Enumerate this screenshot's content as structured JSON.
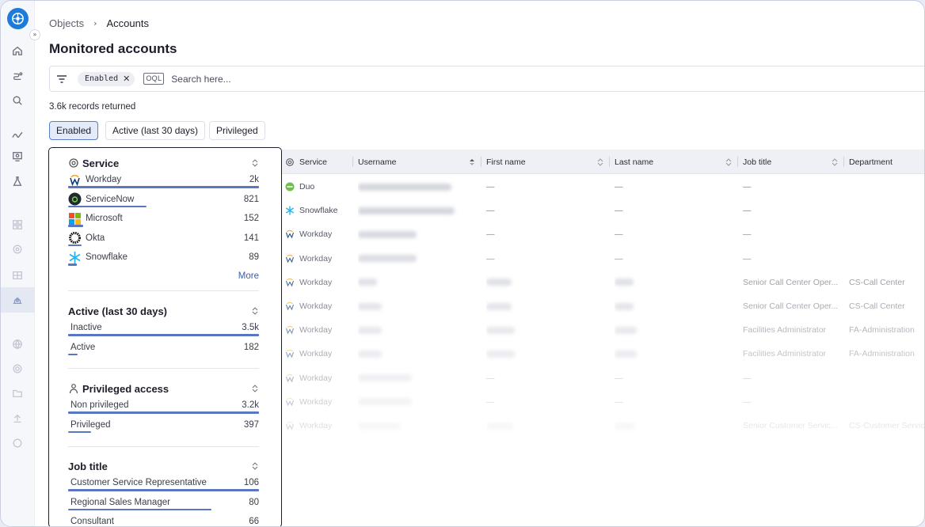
{
  "breadcrumb": {
    "root": "Objects",
    "current": "Accounts"
  },
  "page_title": "Monitored accounts",
  "search": {
    "chip_label": "Enabled",
    "oql_label": "OQL",
    "placeholder": "Search here..."
  },
  "records_returned": "3.6k records returned",
  "quick_filters": [
    "Enabled",
    "Active (last 30 days)",
    "Privileged"
  ],
  "facets": {
    "service": {
      "title": "Service",
      "items": [
        {
          "label": "Workday",
          "count": "2k",
          "fraction": 1.0
        },
        {
          "label": "ServiceNow",
          "count": "821",
          "fraction": 0.41
        },
        {
          "label": "Microsoft",
          "count": "152",
          "fraction": 0.08
        },
        {
          "label": "Okta",
          "count": "141",
          "fraction": 0.07
        },
        {
          "label": "Snowflake",
          "count": "89",
          "fraction": 0.045
        }
      ],
      "more_label": "More"
    },
    "active": {
      "title": "Active (last 30 days)",
      "items": [
        {
          "label": "Inactive",
          "count": "3.5k",
          "fraction": 1.0
        },
        {
          "label": "Active",
          "count": "182",
          "fraction": 0.05
        }
      ]
    },
    "privileged": {
      "title": "Privileged access",
      "items": [
        {
          "label": "Non privileged",
          "count": "3.2k",
          "fraction": 1.0
        },
        {
          "label": "Privileged",
          "count": "397",
          "fraction": 0.12
        }
      ]
    },
    "job_title": {
      "title": "Job title",
      "items": [
        {
          "label": "Customer Service Representative",
          "count": "106",
          "fraction": 1.0
        },
        {
          "label": "Regional Sales Manager",
          "count": "80",
          "fraction": 0.75
        },
        {
          "label": "Consultant",
          "count": "66",
          "fraction": 0.62
        }
      ]
    }
  },
  "table": {
    "columns": [
      "Service",
      "Username",
      "First name",
      "Last name",
      "Job title",
      "Department"
    ],
    "rows": [
      {
        "service": "Duo",
        "first": "—",
        "last": "—",
        "job": "—",
        "dept": ""
      },
      {
        "service": "Snowflake",
        "first": "—",
        "last": "—",
        "job": "—",
        "dept": ""
      },
      {
        "service": "Workday",
        "first": "—",
        "last": "—",
        "job": "—",
        "dept": ""
      },
      {
        "service": "Workday",
        "first": "—",
        "last": "—",
        "job": "—",
        "dept": ""
      },
      {
        "service": "Workday",
        "first": "",
        "last": "",
        "job": "Senior Call Center Oper...",
        "dept": "CS-Call Center"
      },
      {
        "service": "Workday",
        "first": "",
        "last": "",
        "job": "Senior Call Center Oper...",
        "dept": "CS-Call Center"
      },
      {
        "service": "Workday",
        "first": "",
        "last": "",
        "job": "Facilities Administrator",
        "dept": "FA-Administration"
      },
      {
        "service": "Workday",
        "first": "",
        "last": "",
        "job": "Facilities Administrator",
        "dept": "FA-Administration"
      },
      {
        "service": "Workday",
        "first": "—",
        "last": "—",
        "job": "—",
        "dept": ""
      },
      {
        "service": "Workday",
        "first": "—",
        "last": "—",
        "job": "—",
        "dept": ""
      },
      {
        "service": "Workday",
        "first": "",
        "last": "",
        "job": "Senior Customer Servic...",
        "dept": "CS-Customer Service"
      }
    ]
  },
  "colors": {
    "accent": "#5a76c0",
    "brand": "#1c7cd8",
    "link": "#3a5ea8"
  }
}
